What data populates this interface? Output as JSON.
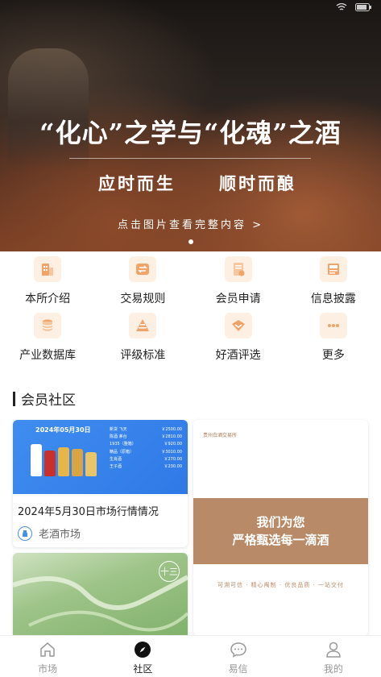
{
  "colors": {
    "accent": "#f0a46a",
    "icon_bg": "#fdf0e3",
    "active": "#222222",
    "inactive": "#999999",
    "blue": "#3f8df0",
    "tan": "#b98a68"
  },
  "banner": {
    "title": "“化心”之学与“化魂”之酒",
    "sub_left": "应时而生",
    "sub_right": "顺时而酿",
    "hint": "点击图片查看完整内容 >",
    "page_count": 1,
    "current_page": 1
  },
  "grid": [
    {
      "label": "本所介绍",
      "icon": "building-icon"
    },
    {
      "label": "交易规则",
      "icon": "exchange-icon"
    },
    {
      "label": "会员申请",
      "icon": "form-icon"
    },
    {
      "label": "信息披露",
      "icon": "document-icon"
    },
    {
      "label": "产业数据库",
      "icon": "database-icon"
    },
    {
      "label": "评级标准",
      "icon": "pyramid-icon"
    },
    {
      "label": "好酒评选",
      "icon": "ribbon-icon"
    },
    {
      "label": "更多",
      "icon": "more-icon"
    }
  ],
  "section": {
    "title": "会员社区"
  },
  "cards": {
    "market": {
      "thumb_date": "2024年05月30日",
      "title": "2024年5月30日市场行情情况",
      "source": "老酒市场",
      "table": [
        {
          "name": "新货 飞天",
          "price": "￥2500.00"
        },
        {
          "name": "陈酒 茅台",
          "price": "￥2810.00"
        },
        {
          "name": "1935（整箱）",
          "price": "￥920.00"
        },
        {
          "name": "精品（原箱）",
          "price": "￥3010.00"
        },
        {
          "name": "生肖酒",
          "price": "￥270.00"
        },
        {
          "name": "王子酒",
          "price": "￥230.00"
        }
      ]
    },
    "promo": {
      "logo": "贵州白酒交易所",
      "line1": "我们为您",
      "line2": "严格甄选每一滴酒",
      "tagline": "可溯可信 · 精心阄制 · 优良品质 · 一站交付"
    },
    "landscape": {
      "badge": "十三"
    }
  },
  "tabbar": [
    {
      "label": "市场",
      "icon": "home-icon",
      "active": false
    },
    {
      "label": "社区",
      "icon": "compass-icon",
      "active": true
    },
    {
      "label": "易信",
      "icon": "chat-icon",
      "active": false
    },
    {
      "label": "我的",
      "icon": "user-icon",
      "active": false
    }
  ]
}
